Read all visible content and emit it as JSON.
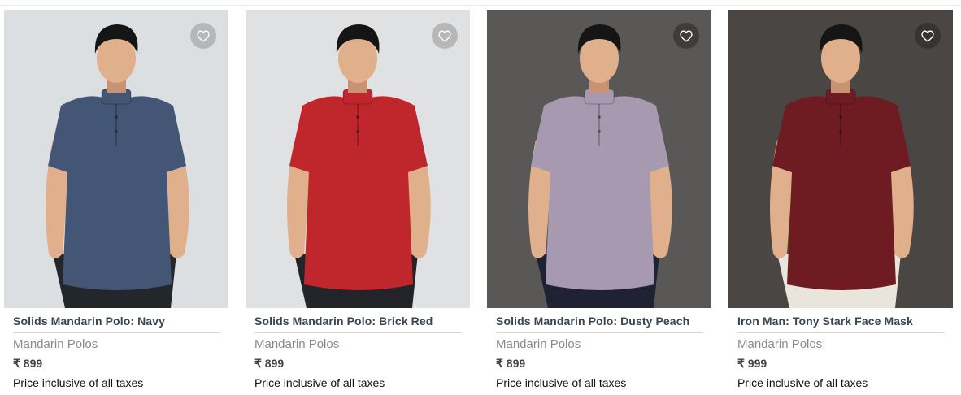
{
  "products": [
    {
      "title": "Solids Mandarin Polo: Navy",
      "category": "Mandarin Polos",
      "price": "₹ 899",
      "tax_note": "Price inclusive of all taxes",
      "bg_color": "#dcdfe2",
      "shirt_color": "#435675",
      "pants_color": "#23262b",
      "wishlist_icon": "heart-outline-icon"
    },
    {
      "title": "Solids Mandarin Polo: Brick Red",
      "category": "Mandarin Polos",
      "price": "₹ 899",
      "tax_note": "Price inclusive of all taxes",
      "bg_color": "#dfe1e3",
      "shirt_color": "#c0272d",
      "pants_color": "#22242a",
      "wishlist_icon": "heart-outline-icon"
    },
    {
      "title": "Solids Mandarin Polo: Dusty Peach",
      "category": "Mandarin Polos",
      "price": "₹ 899",
      "tax_note": "Price inclusive of all taxes",
      "bg_color": "#5a5856",
      "shirt_color": "#a79ab0",
      "pants_color": "#1f2233",
      "wishlist_icon": "heart-outline-icon"
    },
    {
      "title": "Iron Man: Tony Stark Face Mask",
      "category": "Mandarin Polos",
      "price": "₹ 999",
      "tax_note": "Price inclusive of all taxes",
      "bg_color": "#4a4644",
      "shirt_color": "#6e1c22",
      "pants_color": "#e9e4dc",
      "wishlist_icon": "heart-outline-icon"
    }
  ]
}
